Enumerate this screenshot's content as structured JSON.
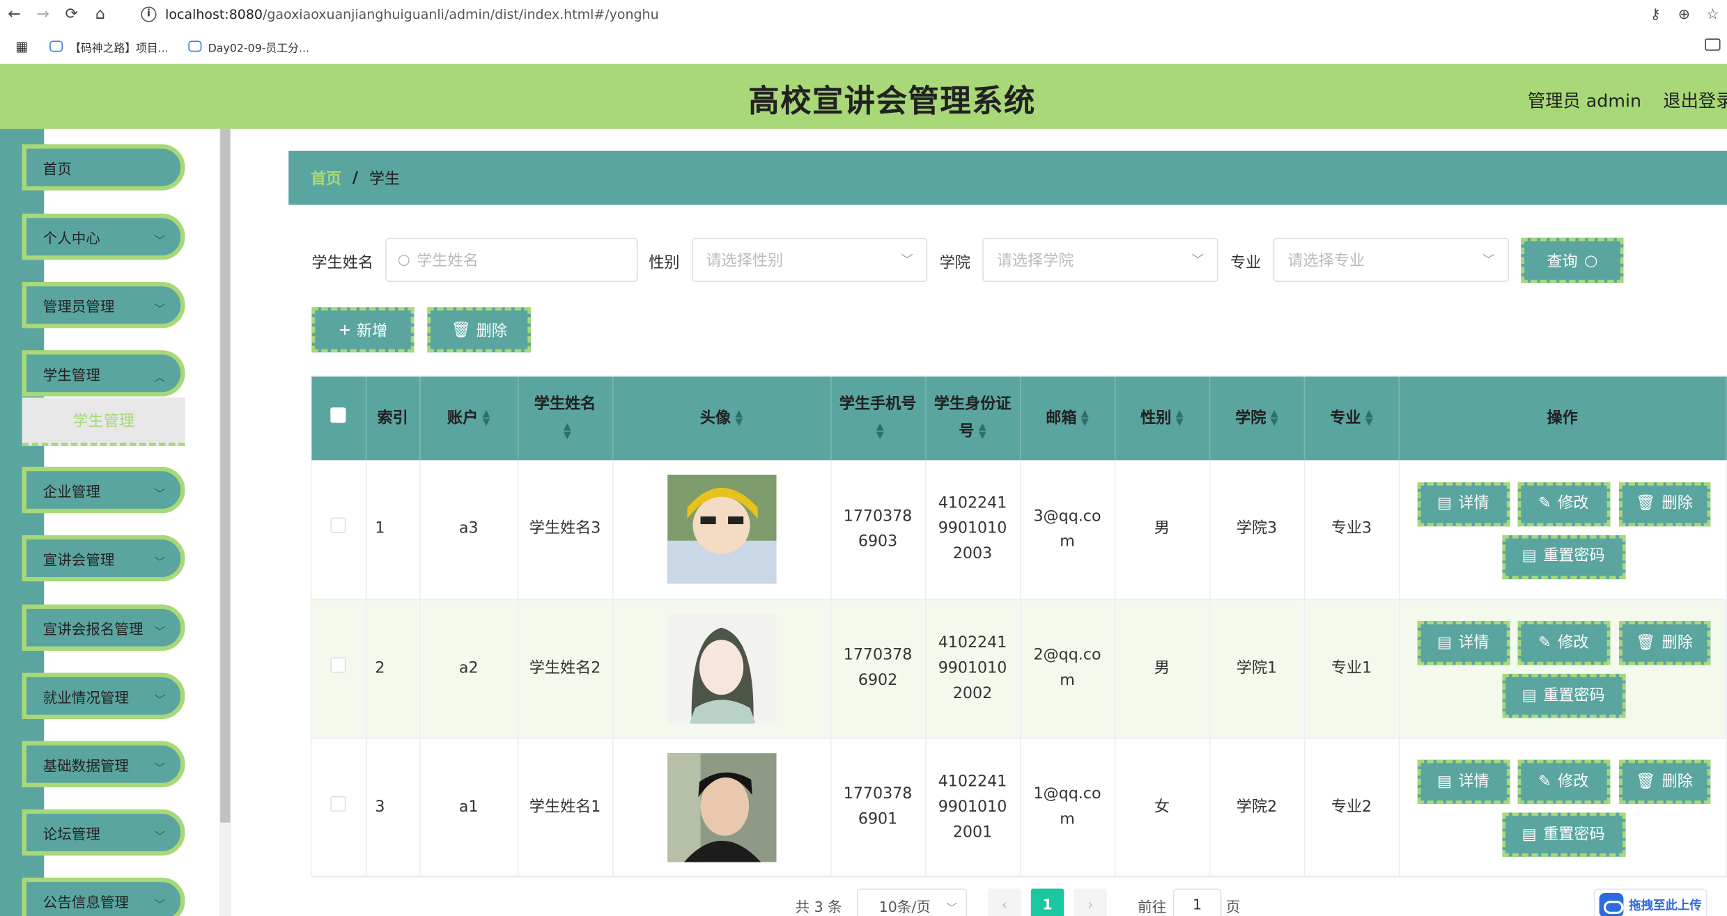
{
  "browser": {
    "url_host": "localhost:8080",
    "url_path": "/gaoxiaoxuanjianghuiguanli/admin/dist/index.html#/yonghu",
    "bookmarks": [
      "【码神之路】项目...",
      "Day02-09-员工分..."
    ],
    "icons": [
      "back-icon",
      "forward-icon",
      "reload-icon",
      "home-icon",
      "info-icon",
      "key-icon",
      "zoom-icon",
      "star-icon",
      "apps-icon",
      "folder-icon"
    ]
  },
  "header": {
    "title": "高校宣讲会管理系统",
    "user": "管理员 admin",
    "logout": "退出登录"
  },
  "sidebar": {
    "items": [
      {
        "label": "首页",
        "chevron": false
      },
      {
        "label": "个人中心",
        "chevron": true
      },
      {
        "label": "管理员管理",
        "chevron": true
      },
      {
        "label": "学生管理",
        "chevron": true
      },
      {
        "label": "企业管理",
        "chevron": true
      },
      {
        "label": "宣讲会管理",
        "chevron": true
      },
      {
        "label": "宣讲会报名管理",
        "chevron": true
      },
      {
        "label": "就业情况管理",
        "chevron": true
      },
      {
        "label": "基础数据管理",
        "chevron": true
      },
      {
        "label": "论坛管理",
        "chevron": true
      },
      {
        "label": "公告信息管理",
        "chevron": true
      }
    ],
    "active_sub": "学生管理"
  },
  "breadcrumb": {
    "home": "首页",
    "sep": "/",
    "current": "学生"
  },
  "filters": {
    "name_label": "学生姓名",
    "name_placeholder": "学生姓名",
    "gender_label": "性别",
    "gender_placeholder": "请选择性别",
    "college_label": "学院",
    "college_placeholder": "请选择学院",
    "major_label": "专业",
    "major_placeholder": "请选择专业",
    "search_button": "查询"
  },
  "actions": {
    "add": "新增",
    "delete": "删除"
  },
  "table": {
    "headers": {
      "index": "索引",
      "account": "账户",
      "name": "学生姓名",
      "avatar": "头像",
      "phone": "学生手机号",
      "idcard": "学生身份证号",
      "email": "邮箱",
      "gender": "性别",
      "college": "学院",
      "major": "专业",
      "ops": "操作"
    },
    "rows": [
      {
        "index": "1",
        "account": "a3",
        "name": "学生姓名3",
        "phone": "17703786903",
        "idcard": "410224199010102003",
        "email": "3@qq.com",
        "gender": "男",
        "college": "学院3",
        "major": "专业3"
      },
      {
        "index": "2",
        "account": "a2",
        "name": "学生姓名2",
        "phone": "17703786902",
        "idcard": "410224199010102002",
        "email": "2@qq.com",
        "gender": "男",
        "college": "学院1",
        "major": "专业1"
      },
      {
        "index": "3",
        "account": "a1",
        "name": "学生姓名1",
        "phone": "17703786901",
        "idcard": "410224199010102001",
        "email": "1@qq.com",
        "gender": "女",
        "college": "学院2",
        "major": "专业2"
      }
    ],
    "ops": {
      "detail": "详情",
      "edit": "修改",
      "delete": "删除",
      "reset": "重置密码"
    }
  },
  "pagination": {
    "total": "共 3 条",
    "page_size": "10条/页",
    "current": "1",
    "goto": "前往",
    "goto_value": "1",
    "page_suffix": "页"
  },
  "upload": {
    "label": "拖拽至此上传"
  },
  "colors": {
    "primary": "#5ba5a0",
    "accent": "#a8d878",
    "pager_active": "#1bc7a0"
  }
}
